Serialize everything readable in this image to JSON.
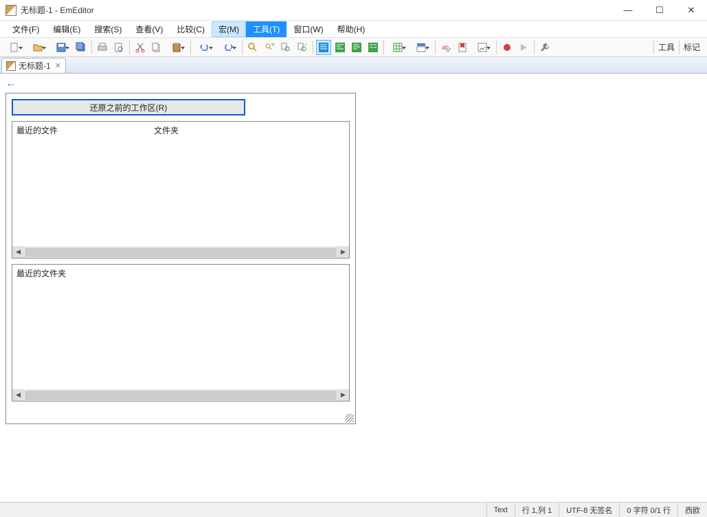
{
  "window": {
    "title": "无标题-1 - EmEditor"
  },
  "menu": {
    "file": "文件(F)",
    "edit": "编辑(E)",
    "search": "搜索(S)",
    "view": "查看(V)",
    "compare": "比较(C)",
    "macro": "宏(M)",
    "tools": "工具(T)",
    "window": "窗口(W)",
    "help": "帮助(H)"
  },
  "toolbar_labels": {
    "tools": "工具",
    "marks": "标记"
  },
  "tab": {
    "label": "无标题-1"
  },
  "panel": {
    "restore": "还原之前的工作区(R)",
    "recent_files": "最近的文件",
    "folders": "文件夹",
    "recent_folders": "最近的文件夹"
  },
  "status": {
    "text": "Text",
    "pos": "行 1,列 1",
    "encoding": "UTF-8 无签名",
    "counts": "0 字符 0/1 行",
    "extra": "西欧"
  }
}
